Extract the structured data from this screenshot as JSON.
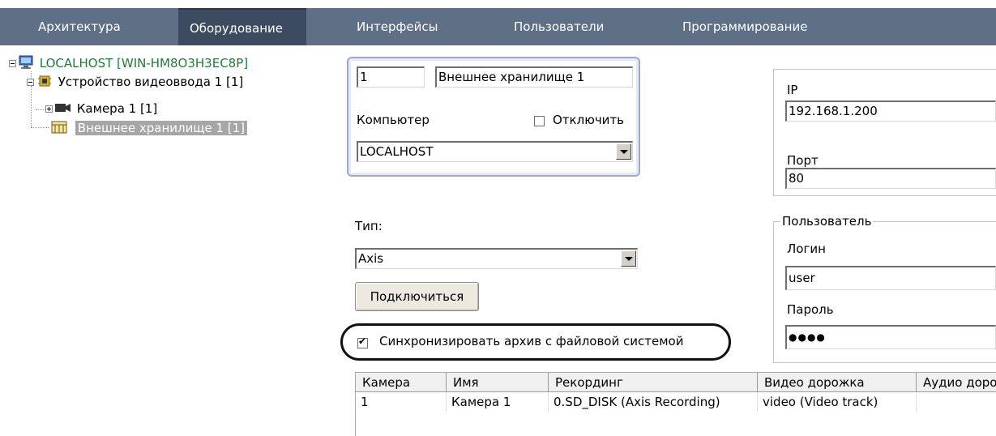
{
  "menu": {
    "tabs": [
      {
        "label": "Архитектура"
      },
      {
        "label": "Оборудование"
      },
      {
        "label": "Интерфейсы"
      },
      {
        "label": "Пользователи"
      },
      {
        "label": "Программирование"
      }
    ],
    "active_tab_index": 1
  },
  "tree": {
    "items": [
      {
        "label": "LOCALHOST [WIN-HM8O3H3EC8P]",
        "icon": "computer-icon"
      },
      {
        "label": "Устройство видеоввода 1 [1]",
        "icon": "video-capture-board-icon"
      },
      {
        "label": "Камера 1 [1]",
        "icon": "camera-icon"
      },
      {
        "label": "Внешнее хранилище 1 [1]",
        "icon": "storage-icon",
        "selected": true
      }
    ]
  },
  "form": {
    "id_value": "1",
    "name_value": "Внешнее хранилище 1",
    "computer_label": "Компьютер",
    "disable_label": "Отключить",
    "disable_checked": false,
    "computer_value": "LOCALHOST",
    "type_label": "Тип:",
    "type_value": "Axis",
    "connect_button": "Подключиться",
    "sync_label": "Синхронизировать архив с файловой системой",
    "sync_checked": true,
    "ip_label": "IP",
    "ip_value": "192.168.1.200",
    "port_label": "Порт",
    "port_value": "80",
    "user_group_label": "Пользователь",
    "login_label": "Логин",
    "login_value": "user",
    "password_label": "Пароль",
    "password_value": "●●●●"
  },
  "table": {
    "columns": [
      "Камера",
      "Имя",
      "Рекординг",
      "Видео дорожка",
      "Аудио доро"
    ],
    "rows": [
      [
        "1",
        "Камера 1",
        "0.SD_DISK (Axis Recording)",
        "video (Video track)",
        ""
      ]
    ]
  },
  "colors": {
    "menu_bg": "#5e6f86",
    "menu_active_bg": "#3d4b61",
    "tree_root_text": "#1f7a3a",
    "selection_bg": "#a6a6a6"
  }
}
